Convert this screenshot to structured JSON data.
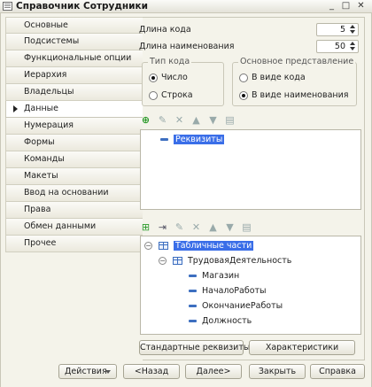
{
  "window": {
    "title": "Справочник Сотрудники",
    "buttons": [
      "_",
      "□",
      "✕"
    ]
  },
  "sidebar": {
    "items": [
      {
        "label": "Основные",
        "active": false
      },
      {
        "label": "Подсистемы",
        "active": false
      },
      {
        "label": "Функциональные опции",
        "active": false
      },
      {
        "label": "Иерархия",
        "active": false
      },
      {
        "label": "Владельцы",
        "active": false
      },
      {
        "label": "Данные",
        "active": true
      },
      {
        "label": "Нумерация",
        "active": false
      },
      {
        "label": "Формы",
        "active": false
      },
      {
        "label": "Команды",
        "active": false
      },
      {
        "label": "Макеты",
        "active": false
      },
      {
        "label": "Ввод на основании",
        "active": false
      },
      {
        "label": "Права",
        "active": false
      },
      {
        "label": "Обмен данными",
        "active": false
      },
      {
        "label": "Прочее",
        "active": false
      }
    ]
  },
  "data_tab": {
    "code_length_label": "Длина кода",
    "code_length_value": "5",
    "name_length_label": "Длина наименования",
    "name_length_value": "50",
    "code_type": {
      "legend": "Тип кода",
      "options": [
        "Число",
        "Строка"
      ],
      "selected": "Число"
    },
    "main_presentation": {
      "legend": "Основное представление",
      "options": [
        "В виде кода",
        "В виде наименования"
      ],
      "selected": "В виде наименования"
    },
    "attributes_toolbar": [
      "add-icon",
      "edit-icon",
      "delete-icon",
      "move-up-icon",
      "move-down-icon",
      "sort-icon"
    ],
    "attributes_tree": {
      "root": "Реквизиты"
    },
    "tabular_toolbar": [
      "add-table-icon",
      "add-attribute-icon",
      "edit-icon",
      "delete-icon",
      "move-up-icon",
      "move-down-icon",
      "sort-icon"
    ],
    "tabular_tree": {
      "root": "Табличные части",
      "table": "ТрудоваяДеятельность",
      "fields": [
        "Магазин",
        "НачалоРаботы",
        "ОкончаниеРаботы",
        "Должность"
      ]
    },
    "standard_attributes_button": "Стандартные реквизиты",
    "characteristics_button": "Характеристики"
  },
  "footer": {
    "actions_label": "Действия",
    "back_label": "<Назад",
    "next_label": "Далее>",
    "close_label": "Закрыть",
    "help_label": "Справка"
  }
}
